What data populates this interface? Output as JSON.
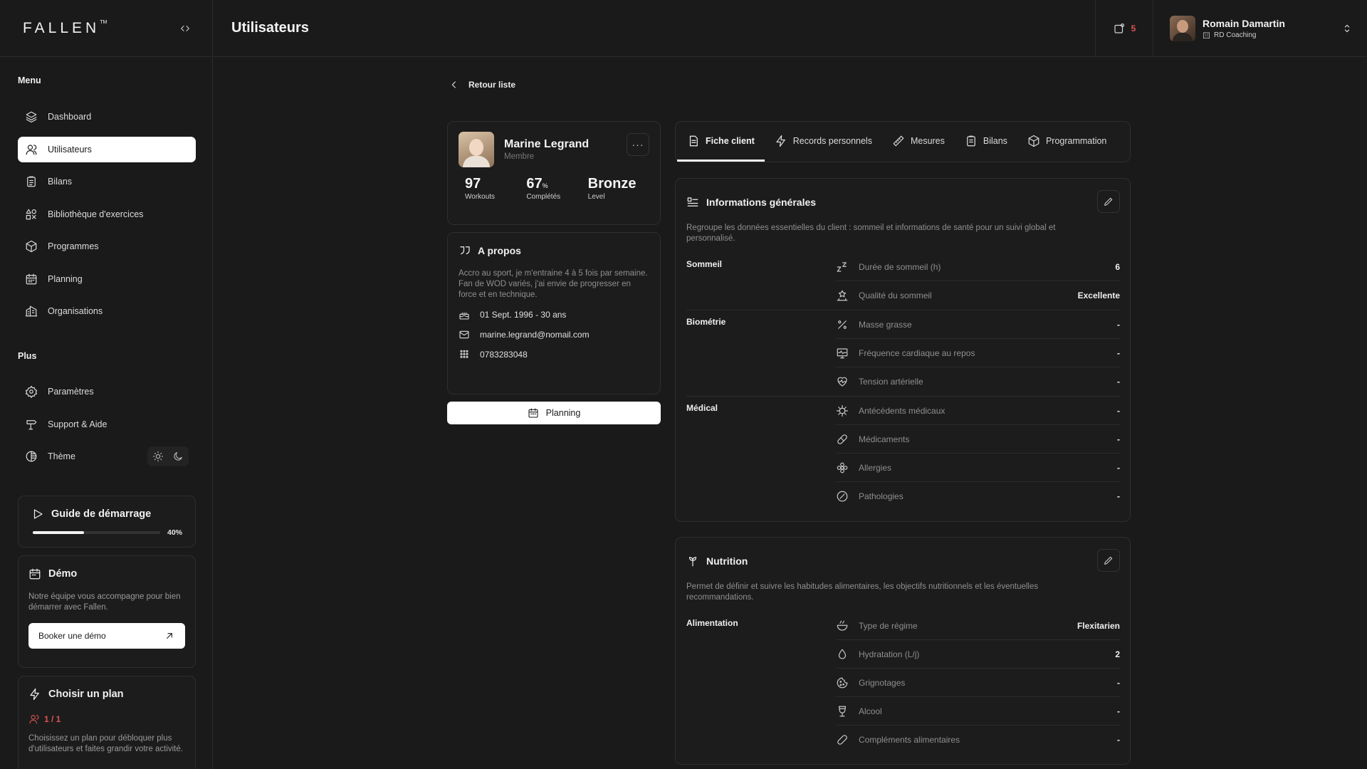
{
  "brand": {
    "logo": "FALLEN",
    "tm": "TM"
  },
  "header": {
    "title": "Utilisateurs",
    "notif_count": "5"
  },
  "user": {
    "name": "Romain Damartin",
    "org": "RD Coaching"
  },
  "sidebar": {
    "menu_title": "Menu",
    "items": [
      {
        "label": "Dashboard",
        "icon": "layers-icon"
      },
      {
        "label": "Utilisateurs",
        "icon": "users-icon",
        "active": true
      },
      {
        "label": "Bilans",
        "icon": "clipboard-icon"
      },
      {
        "label": "Bibliothèque d'exercices",
        "icon": "shapes-icon"
      },
      {
        "label": "Programmes",
        "icon": "box-icon"
      },
      {
        "label": "Planning",
        "icon": "calendar-icon"
      },
      {
        "label": "Organisations",
        "icon": "building-icon"
      }
    ],
    "plus_title": "Plus",
    "plus_items": [
      {
        "label": "Paramètres",
        "icon": "gear-icon"
      },
      {
        "label": "Support & Aide",
        "icon": "signpost-icon"
      },
      {
        "label": "Thème",
        "icon": "theme-icon"
      }
    ],
    "guide": {
      "title": "Guide de démarrage",
      "progress": 0.4,
      "progress_label": "40%"
    },
    "demo": {
      "title": "Démo",
      "text": "Notre équipe vous accompagne pour bien démarrer avec Fallen.",
      "button": "Booker une démo"
    },
    "plan": {
      "title": "Choisir un plan",
      "count": "1 / 1",
      "text": "Choisissez un plan pour débloquer plus d'utilisateurs et faites grandir votre activité."
    }
  },
  "back_label": "Retour liste",
  "profile": {
    "name": "Marine Legrand",
    "role": "Membre",
    "stats": [
      {
        "value": "97",
        "unit": "",
        "label": "Workouts"
      },
      {
        "value": "67",
        "unit": "%",
        "label": "Complétés"
      },
      {
        "value": "Bronze",
        "unit": "",
        "label": "Level"
      }
    ]
  },
  "about": {
    "title": "A propos",
    "text_1": "Accro au sport, je m'entraine 4 à 5 fois par semaine.",
    "text_2": "Fan de WOD variés, j'ai envie de progresser en force et en technique.",
    "birth": "01 Sept. 1996 - 30 ans",
    "email": "marine.legrand@nomail.com",
    "phone": "0783283048"
  },
  "planning_button": "Planning",
  "tabs": [
    {
      "label": "Fiche client",
      "active": true
    },
    {
      "label": "Records personnels"
    },
    {
      "label": "Mesures"
    },
    {
      "label": "Bilans"
    },
    {
      "label": "Programmation"
    }
  ],
  "info": {
    "title": "Informations générales",
    "desc": "Regroupe les données essentielles du client : sommeil et informations de santé pour un suivi global et personnalisé.",
    "groups": [
      {
        "label": "Sommeil",
        "rows": [
          {
            "label": "Durée de sommeil (h)",
            "value": "6",
            "icon": "zzz-icon"
          },
          {
            "label": "Qualité du sommeil",
            "value": "Excellente",
            "icon": "stars-icon"
          }
        ]
      },
      {
        "label": "Biométrie",
        "rows": [
          {
            "label": "Masse grasse",
            "value": "-",
            "icon": "percent-icon"
          },
          {
            "label": "Fréquence cardiaque au repos",
            "value": "-",
            "icon": "monitor-heart-icon"
          },
          {
            "label": "Tension artérielle",
            "value": "-",
            "icon": "heart-pulse-icon"
          }
        ]
      },
      {
        "label": "Médical",
        "rows": [
          {
            "label": "Antécédents médicaux",
            "value": "-",
            "icon": "virus-icon"
          },
          {
            "label": "Médicaments",
            "value": "-",
            "icon": "pill-icon"
          },
          {
            "label": "Allergies",
            "value": "-",
            "icon": "flower-icon"
          },
          {
            "label": "Pathologies",
            "value": "-",
            "icon": "prohibit-icon"
          }
        ]
      }
    ]
  },
  "nutrition": {
    "title": "Nutrition",
    "desc": "Permet de définir et suivre les habitudes alimentaires, les objectifs nutritionnels et les éventuelles recommandations.",
    "groups": [
      {
        "label": "Alimentation",
        "rows": [
          {
            "label": "Type de régime",
            "value": "Flexitarien",
            "icon": "bowl-icon"
          },
          {
            "label": "Hydratation (L/j)",
            "value": "2",
            "icon": "droplet-icon"
          },
          {
            "label": "Grignotages",
            "value": "-",
            "icon": "cookie-icon"
          },
          {
            "label": "Alcool",
            "value": "-",
            "icon": "glass-icon"
          },
          {
            "label": "Compléments alimentaires",
            "value": "-",
            "icon": "capsule-icon"
          }
        ]
      }
    ]
  }
}
